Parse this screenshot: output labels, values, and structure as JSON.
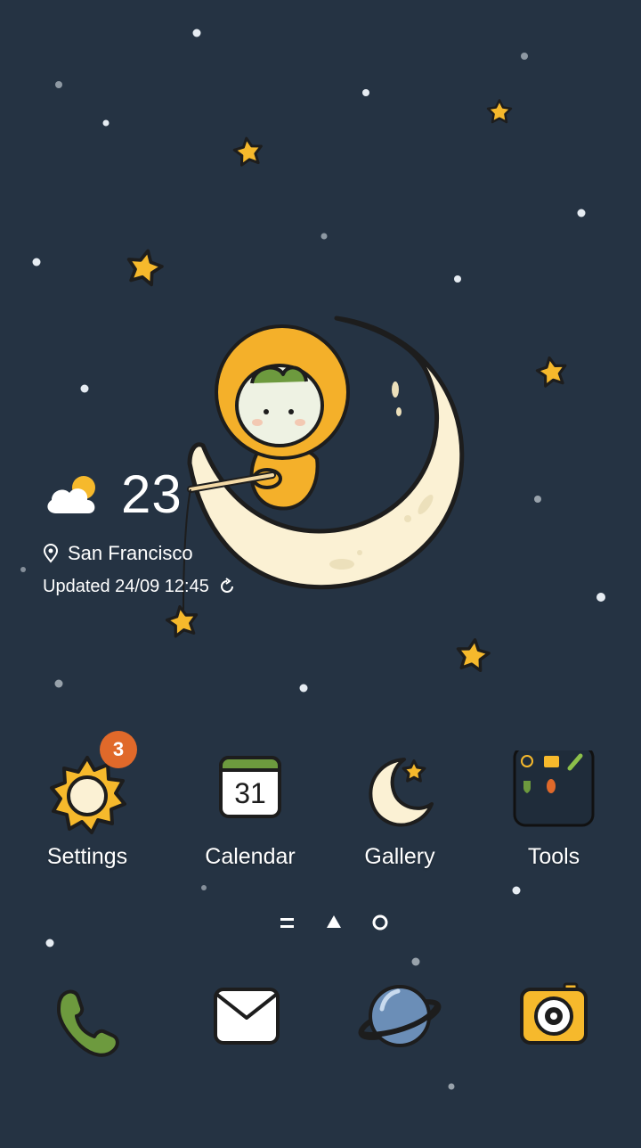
{
  "weather": {
    "temperature": "23",
    "location": "San Francisco",
    "updated": "Updated 24/09 12:45",
    "condition_icon": "partly-cloudy-icon"
  },
  "apps": [
    {
      "label": "Settings",
      "icon": "settings-sun-icon",
      "badge": "3"
    },
    {
      "label": "Calendar",
      "icon": "calendar-icon",
      "date": "31"
    },
    {
      "label": "Gallery",
      "icon": "gallery-moon-icon"
    },
    {
      "label": "Tools",
      "icon": "tools-folder-icon"
    }
  ],
  "page_indicator": [
    "menu-page",
    "home-page",
    "current-page"
  ],
  "dock": [
    {
      "icon": "phone-icon"
    },
    {
      "icon": "messages-icon"
    },
    {
      "icon": "browser-planet-icon"
    },
    {
      "icon": "camera-icon"
    }
  ],
  "colors": {
    "background": "#253343",
    "star": "#f6b92c",
    "moon": "#fbf1d4",
    "character": "#f4b02a",
    "badge": "#e0692a"
  }
}
